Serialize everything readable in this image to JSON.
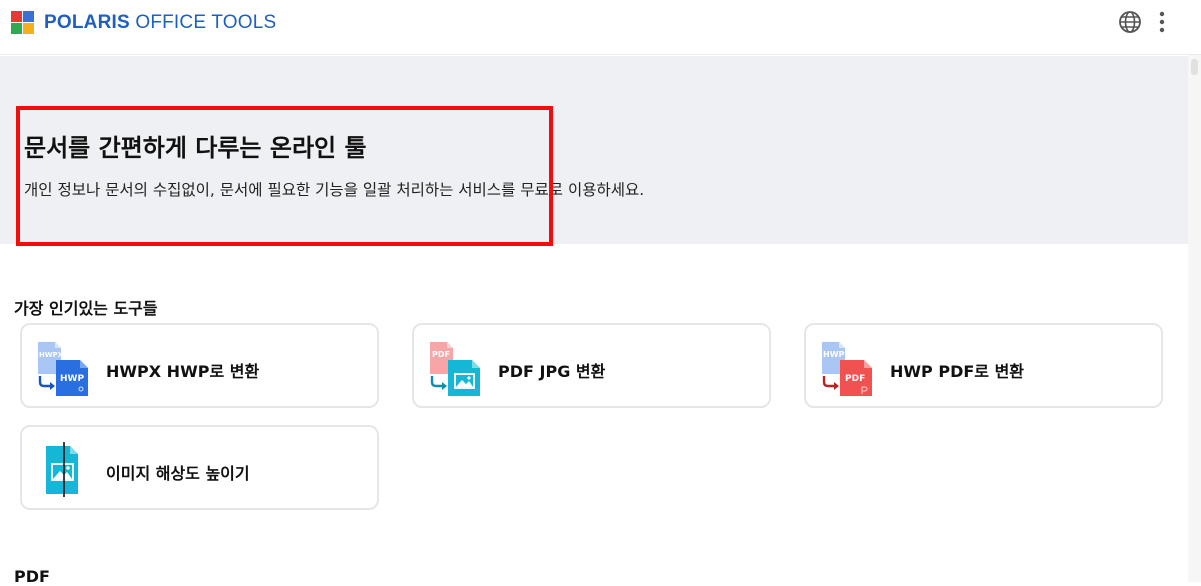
{
  "header": {
    "brand_bold": "POLARIS",
    "brand_light": " OFFICE TOOLS",
    "logo_colors": [
      "#e63c2f",
      "#3b6fd8",
      "#2eaa4f",
      "#f2b01e"
    ],
    "actions": [
      {
        "name": "globe-icon",
        "label": "language"
      },
      {
        "name": "kebab-menu-icon",
        "label": "more"
      }
    ]
  },
  "hero": {
    "title": "문서를 간편하게 다루는 온라인 툴",
    "subtitle": "개인 정보나 문서의 수집없이, 문서에 필요한 기능을 일괄 처리하는 서비스를 무료로 이용하세요.",
    "highlight_color": "#f20c0c"
  },
  "sections": {
    "popular": {
      "title": "가장 인기있는 도구들",
      "tools": [
        {
          "label": "HWPX HWP로 변환",
          "icon": "hwpx-to-hwp-icon",
          "src_tag": "HWPX",
          "dst_tag": "HWP",
          "dst_color": "#2a6fe0"
        },
        {
          "label": "PDF JPG 변환",
          "icon": "pdf-to-jpg-icon",
          "src_tag": "PDF",
          "dst_tag": "",
          "dst_color": "#15b7d6"
        },
        {
          "label": "HWP PDF로 변환",
          "icon": "hwp-to-pdf-icon",
          "src_tag": "HWP",
          "dst_tag": "PDF",
          "dst_color": "#f15150"
        },
        {
          "label": "이미지 해상도 높이기",
          "icon": "image-upscale-icon",
          "src_tag": "",
          "dst_tag": "",
          "dst_color": "#15b7d6"
        }
      ]
    },
    "pdf": {
      "title": "PDF"
    }
  }
}
